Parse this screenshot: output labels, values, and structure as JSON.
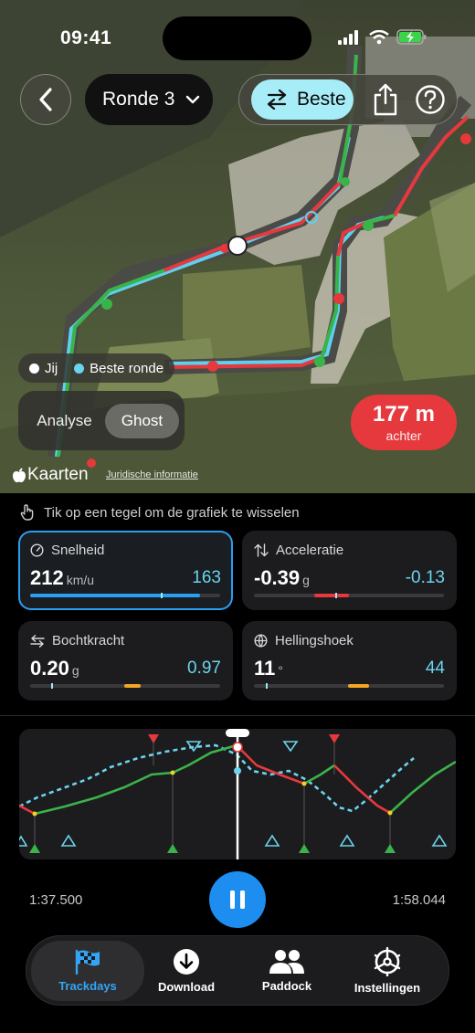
{
  "status": {
    "time": "09:41"
  },
  "header": {
    "lap_label": "Ronde 3",
    "best_label": "Beste"
  },
  "map": {
    "legend": {
      "you": "Jij",
      "best": "Beste ronde"
    },
    "modes": {
      "analyse": "Analyse",
      "ghost": "Ghost"
    },
    "gap": {
      "value": "177 m",
      "label": "achter"
    },
    "brand": "Kaarten",
    "legal": "Juridische informatie"
  },
  "hint": "Tik op een tegel om de grafiek te wisselen",
  "tiles": [
    {
      "name": "speed",
      "label": "Snelheid",
      "value": "212",
      "unit": "km/u",
      "ref": "163",
      "icon": "speedometer-icon",
      "fill_fraction": 0.9,
      "marker_fraction": 0.69,
      "color": "#2a9ff0"
    },
    {
      "name": "acceleration",
      "label": "Acceleratie",
      "value": "-0.39",
      "unit": "g",
      "ref": "-0.13",
      "icon": "up-down-arrows-icon",
      "color": "#e5393d"
    },
    {
      "name": "cornering",
      "label": "Bochtkracht",
      "value": "0.20",
      "unit": "g",
      "ref": "0.97",
      "icon": "left-right-arrows-icon",
      "color": "#f5a623"
    },
    {
      "name": "lean",
      "label": "Hellingshoek",
      "value": "11",
      "unit": "°",
      "ref": "44",
      "icon": "globe-icon",
      "color": "#f5a623"
    }
  ],
  "playback": {
    "start": "1:37.500",
    "end": "1:58.044"
  },
  "tabs": [
    {
      "label": "Trackdays",
      "icon": "checkered-flag-icon"
    },
    {
      "label": "Download",
      "icon": "download-icon"
    },
    {
      "label": "Paddock",
      "icon": "people-icon"
    },
    {
      "label": "Instellingen",
      "icon": "steering-wheel-icon"
    }
  ],
  "colors": {
    "accent": "#2a9ff0",
    "ghost": "#6ad4ee",
    "fast": "#3ab34a",
    "slow": "#e5393d",
    "gap_badge": "#e5393d"
  }
}
